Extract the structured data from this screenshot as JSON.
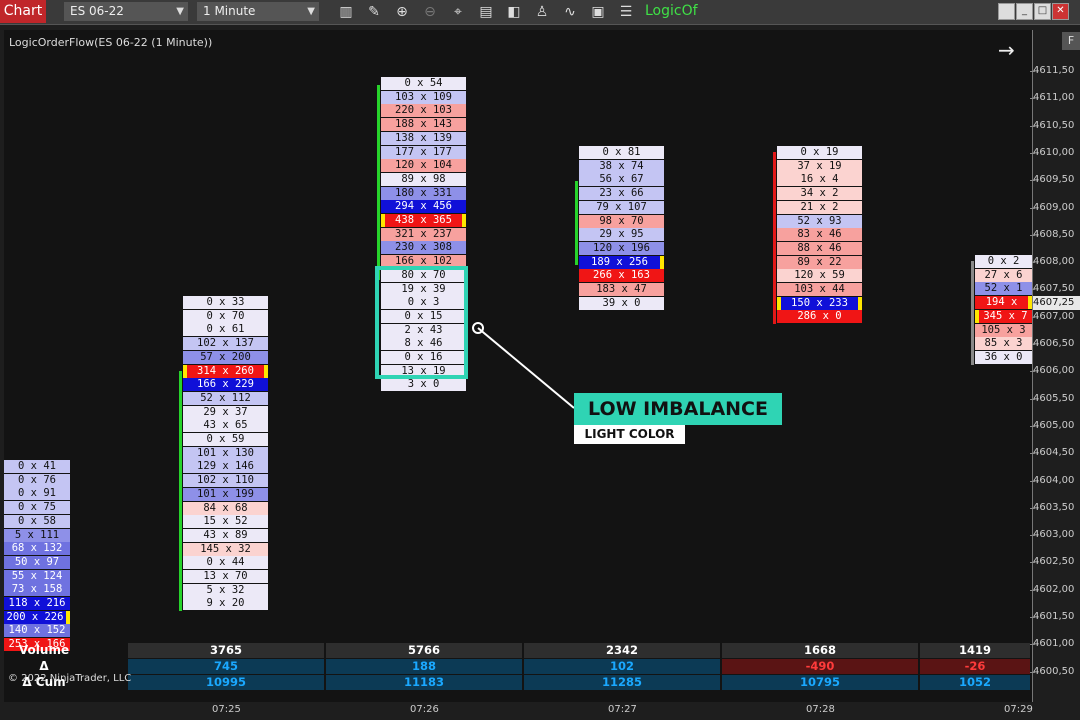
{
  "toolbar": {
    "chart_tab": "Chart",
    "instrument": "ES 06-22",
    "timeframe": "1 Minute",
    "brand": "LogicOf",
    "icons": [
      "bars-icon",
      "pencil-icon",
      "zoom-in-icon",
      "zoom-out-icon",
      "crosshair-icon",
      "properties-icon",
      "templates-icon",
      "strategies-icon",
      "indicators-icon",
      "chart-trader-icon",
      "data-box-icon"
    ]
  },
  "chart": {
    "title": "LogicOrderFlow(ES 06-22 (1 Minute))",
    "current_price": "4607,25",
    "y_ticks": [
      "4611,50",
      "4611,00",
      "4610,50",
      "4610,00",
      "4609,50",
      "4609,00",
      "4608,50",
      "4608,00",
      "4607,50",
      "4607,00",
      "4606,50",
      "4606,00",
      "4605,50",
      "4605,00",
      "4604,50",
      "4604,00",
      "4603,50",
      "4603,00",
      "4602,50",
      "4602,00",
      "4601,50",
      "4601,00",
      "4600,50"
    ],
    "x_labels": [
      "07:25",
      "07:26",
      "07:27",
      "07:28",
      "07:29"
    ]
  },
  "bars": [
    {
      "x": 4,
      "w": 66,
      "top": 460,
      "delta": "none",
      "rows": [
        [
          "0 x 41",
          "light-blue",
          0,
          0
        ],
        [
          "0 x 76",
          "light-blue",
          0,
          0
        ],
        [
          "0 x 91",
          "light-blue",
          0,
          0
        ],
        [
          "0 x 75",
          "light-blue",
          0,
          0
        ],
        [
          "0 x 58",
          "light-blue",
          0,
          0
        ],
        [
          "5 x 111",
          "mid-blue",
          0,
          0
        ],
        [
          "68 x 132",
          "blue",
          0,
          0
        ],
        [
          "50 x 97",
          "blue",
          0,
          0
        ],
        [
          "55 x 124",
          "blue",
          0,
          0
        ],
        [
          "73 x 158",
          "blue",
          0,
          0
        ],
        [
          "118 x 216",
          "dark-blue",
          0,
          0
        ],
        [
          "200 x 226",
          "dark-blue",
          0,
          1
        ],
        [
          "140 x 152",
          "blue",
          0,
          0
        ],
        [
          "253 x 166",
          "red",
          0,
          0
        ]
      ]
    },
    {
      "x": 183,
      "w": 85,
      "top": 296,
      "delta": "pos",
      "rows": [
        [
          "0 x 33",
          "pale",
          0,
          0
        ],
        [
          "0 x 70",
          "pale",
          0,
          0
        ],
        [
          "0 x 61",
          "pale",
          0,
          0
        ],
        [
          "102 x 137",
          "light-blue",
          0,
          0
        ],
        [
          "57 x 200",
          "mid-blue",
          0,
          0
        ],
        [
          "314 x 260",
          "red",
          1,
          1
        ],
        [
          "166 x 229",
          "dark-blue",
          0,
          0
        ],
        [
          "52 x 112",
          "light-blue",
          0,
          0
        ],
        [
          "29 x 37",
          "pale",
          0,
          0
        ],
        [
          "43 x 65",
          "pale",
          0,
          0
        ],
        [
          "0 x 59",
          "pale",
          0,
          0
        ],
        [
          "101 x 130",
          "light-blue",
          0,
          0
        ],
        [
          "129 x 146",
          "light-blue",
          0,
          0
        ],
        [
          "102 x 110",
          "light-blue",
          0,
          0
        ],
        [
          "101 x 199",
          "mid-blue",
          0,
          0
        ],
        [
          "84 x 68",
          "pale-red",
          0,
          0
        ],
        [
          "15 x 52",
          "pale",
          0,
          0
        ],
        [
          "43 x 89",
          "pale",
          0,
          0
        ],
        [
          "145 x 32",
          "pale-red",
          0,
          0
        ],
        [
          "0 x 44",
          "pale",
          0,
          0
        ],
        [
          "13 x 70",
          "pale",
          0,
          0
        ],
        [
          "5 x 32",
          "pale",
          0,
          0
        ],
        [
          "9 x 20",
          "pale",
          0,
          0
        ]
      ]
    },
    {
      "x": 381,
      "w": 85,
      "top": 77,
      "delta": "pos",
      "rows": [
        [
          "0 x 54",
          "pale",
          0,
          0
        ],
        [
          "103 x 109",
          "light-blue",
          0,
          0
        ],
        [
          "220 x 103",
          "light-red",
          0,
          0
        ],
        [
          "188 x 143",
          "light-red",
          0,
          0
        ],
        [
          "138 x 139",
          "light-blue",
          0,
          0
        ],
        [
          "177 x 177",
          "light-blue",
          0,
          0
        ],
        [
          "120 x 104",
          "light-red",
          0,
          0
        ],
        [
          "89 x 98",
          "pale",
          0,
          0
        ],
        [
          "180 x 331",
          "mid-blue",
          0,
          0
        ],
        [
          "294 x 456",
          "dark-blue",
          0,
          0
        ],
        [
          "438 x 365",
          "red",
          1,
          1
        ],
        [
          "321 x 237",
          "light-red",
          0,
          0
        ],
        [
          "230 x 308",
          "mid-blue",
          0,
          0
        ],
        [
          "166 x 102",
          "light-red",
          0,
          0
        ],
        [
          "80 x 70",
          "pale",
          0,
          0
        ],
        [
          "19 x 39",
          "pale",
          0,
          0
        ],
        [
          "0 x 3",
          "pale",
          0,
          0
        ],
        [
          "0 x 15",
          "pale",
          0,
          0
        ],
        [
          "2 x 43",
          "pale",
          0,
          0
        ],
        [
          "8 x 46",
          "pale",
          0,
          0
        ],
        [
          "0 x 16",
          "pale",
          0,
          0
        ],
        [
          "13 x 19",
          "pale",
          0,
          0
        ],
        [
          "3 x 0",
          "pale",
          0,
          0
        ]
      ]
    },
    {
      "x": 579,
      "w": 85,
      "top": 146,
      "delta": "pos",
      "rows": [
        [
          "0 x 81",
          "pale",
          0,
          0
        ],
        [
          "38 x 74",
          "light-blue",
          0,
          0
        ],
        [
          "56 x 67",
          "light-blue",
          0,
          0
        ],
        [
          "23 x 66",
          "light-blue",
          0,
          0
        ],
        [
          "79 x 107",
          "light-blue",
          0,
          0
        ],
        [
          "98 x 70",
          "light-red",
          0,
          0
        ],
        [
          "29 x 95",
          "light-blue",
          0,
          0
        ],
        [
          "120 x 196",
          "mid-blue",
          0,
          0
        ],
        [
          "189 x 256",
          "dark-blue",
          0,
          1
        ],
        [
          "266 x 163",
          "red",
          0,
          0
        ],
        [
          "183 x 47",
          "light-red",
          0,
          0
        ],
        [
          "39 x 0",
          "pale",
          0,
          0
        ]
      ]
    },
    {
      "x": 777,
      "w": 85,
      "top": 146,
      "delta": "neg",
      "rows": [
        [
          "0 x 19",
          "pale",
          0,
          0
        ],
        [
          "37 x 19",
          "pale-red",
          0,
          0
        ],
        [
          "16 x 4",
          "pale-red",
          0,
          0
        ],
        [
          "34 x 2",
          "pale-red",
          0,
          0
        ],
        [
          "21 x 2",
          "pale-red",
          0,
          0
        ],
        [
          "52 x 93",
          "light-blue",
          0,
          0
        ],
        [
          "83 x 46",
          "light-red",
          0,
          0
        ],
        [
          "88 x 46",
          "light-red",
          0,
          0
        ],
        [
          "89 x 22",
          "light-red",
          0,
          0
        ],
        [
          "120 x 59",
          "pale-red",
          0,
          0
        ],
        [
          "103 x 44",
          "light-red",
          0,
          0
        ],
        [
          "150 x 233",
          "dark-blue",
          1,
          1
        ],
        [
          "286 x 0",
          "red",
          0,
          0
        ]
      ]
    },
    {
      "x": 975,
      "w": 57,
      "top": 255,
      "delta": "mixed",
      "rows": [
        [
          "0 x 2",
          "pale",
          0,
          0
        ],
        [
          "27 x 6",
          "pale-red",
          0,
          0
        ],
        [
          "52 x 1",
          "mid-blue",
          0,
          0
        ],
        [
          "194 x",
          "red",
          0,
          1
        ],
        [
          "345 x 7",
          "red",
          1,
          0
        ],
        [
          "105 x 3",
          "light-red",
          0,
          0
        ],
        [
          "85 x 3",
          "pale-red",
          0,
          0
        ],
        [
          "36 x 0",
          "pale",
          0,
          0
        ]
      ]
    }
  ],
  "bottom": {
    "labels": [
      "Volume",
      "Δ",
      "Δ Cum"
    ],
    "volume": [
      "3765",
      "5766",
      "2342",
      "1668",
      "1419"
    ],
    "delta": [
      "745",
      "188",
      "102",
      "-490",
      "-26"
    ],
    "delta_cum": [
      "10995",
      "11183",
      "11285",
      "10795",
      "1052"
    ],
    "copyright": "© 2022 NinjaTrader, LLC"
  },
  "callout": {
    "title": "LOW IMBALANCE",
    "subtitle": "LIGHT COLOR"
  },
  "colors": {
    "pale": "#ece9f7",
    "pale-red": "#fbd3d0",
    "light-red": "#f7a19e",
    "red": "#f01515",
    "light-blue": "#c4c5f3",
    "mid-blue": "#8e90e8",
    "blue": "#6f72e0",
    "dark-blue": "#1010d8",
    "positive": "#1aa8ff",
    "negative": "#ff2a2a",
    "accent": "#2fd4b4"
  }
}
